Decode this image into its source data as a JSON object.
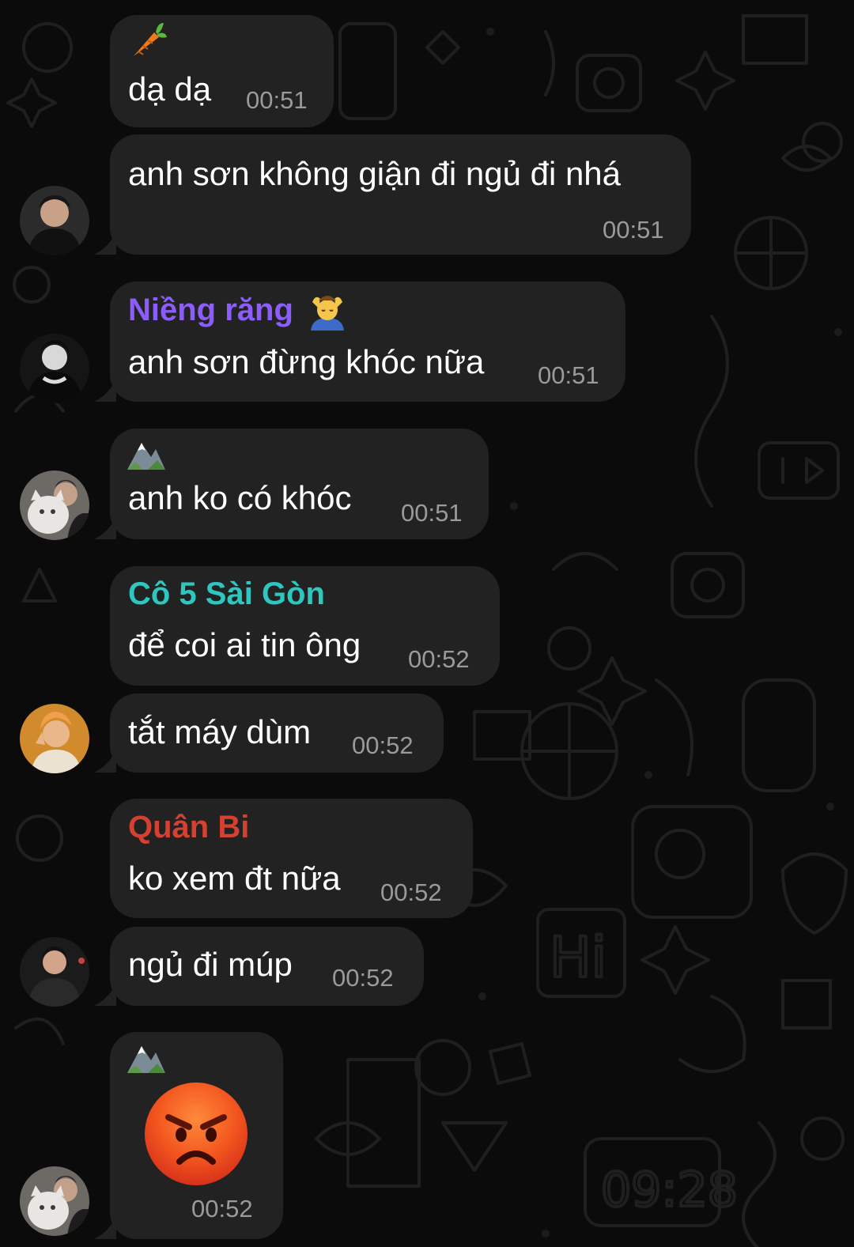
{
  "messages": [
    {
      "id": "m1",
      "text": "dạ dạ",
      "time": "00:51",
      "status_icon": "carrot-icon"
    },
    {
      "id": "m2",
      "text": "anh sơn không giận đi ngủ đi nhá",
      "time": "00:51"
    },
    {
      "id": "m3",
      "sender": "Niềng răng",
      "sender_color": "#8c5cff",
      "sender_emoji": "massage-emoji-icon",
      "text": "anh sơn đừng khóc nữa",
      "time": "00:51"
    },
    {
      "id": "m4",
      "text": "anh ko có khóc",
      "time": "00:51",
      "status_icon": "mountain-icon"
    },
    {
      "id": "m5",
      "sender": "Cô 5 Sài Gòn",
      "sender_color": "#2ec7c0",
      "text": "để coi ai tin ông",
      "time": "00:52"
    },
    {
      "id": "m6",
      "text": "tắt máy dùm",
      "time": "00:52"
    },
    {
      "id": "m7",
      "sender": "Quân Bi",
      "sender_color": "#d64030",
      "text": "ko xem đt nữa",
      "time": "00:52"
    },
    {
      "id": "m8",
      "text": "ngủ đi múp",
      "time": "00:52"
    },
    {
      "id": "m9",
      "sticker": "angry-face-emoji",
      "time": "00:52",
      "status_icon": "mountain-icon"
    }
  ],
  "colors": {
    "background": "#0b0b0b",
    "bubble": "#222222",
    "text": "#ffffff",
    "time": "#9a9a9a"
  }
}
